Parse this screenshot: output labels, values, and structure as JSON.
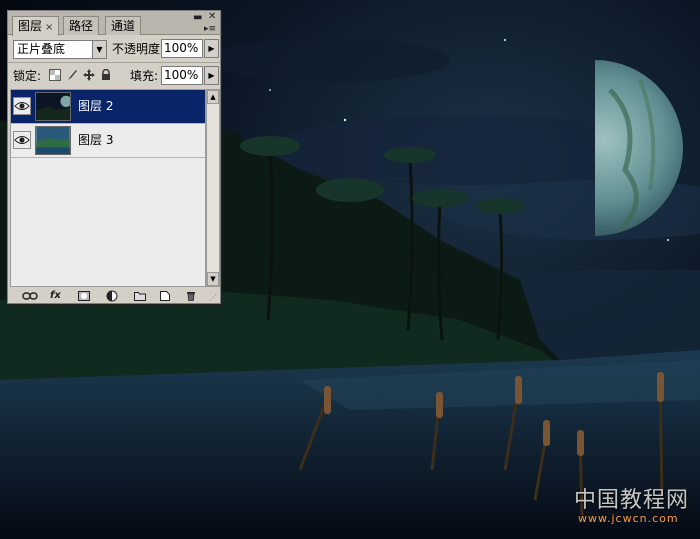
{
  "panel": {
    "tabs": [
      {
        "label": "图层",
        "close": "×"
      },
      {
        "label": "路径"
      },
      {
        "label": "通道"
      }
    ],
    "menu_icon": "panel-menu-icon",
    "blend_mode": "正片叠底",
    "opacity_label": "不透明度:",
    "opacity_value": "100%",
    "lock_label": "锁定:",
    "fill_label": "填充:",
    "fill_value": "100%",
    "lock_icons": [
      "lock-transparent-icon",
      "lock-brush-icon",
      "lock-move-icon",
      "lock-all-icon"
    ],
    "layers": [
      {
        "name": "图层 2",
        "selected": true,
        "visible": true
      },
      {
        "name": "图层 3",
        "selected": false,
        "visible": true
      }
    ],
    "bottom_icons": [
      "link-icon",
      "fx-icon",
      "mask-icon",
      "adjustment-icon",
      "folder-icon",
      "new-layer-icon",
      "trash-icon"
    ],
    "fx_label": "fx"
  },
  "watermark": {
    "title": "中国教程网",
    "url": "www.jcwcn.com"
  },
  "colors": {
    "selected_layer": "#0a246a",
    "panel_bg": "#d4d0c8",
    "watermark_url": "#ff9a3c"
  }
}
